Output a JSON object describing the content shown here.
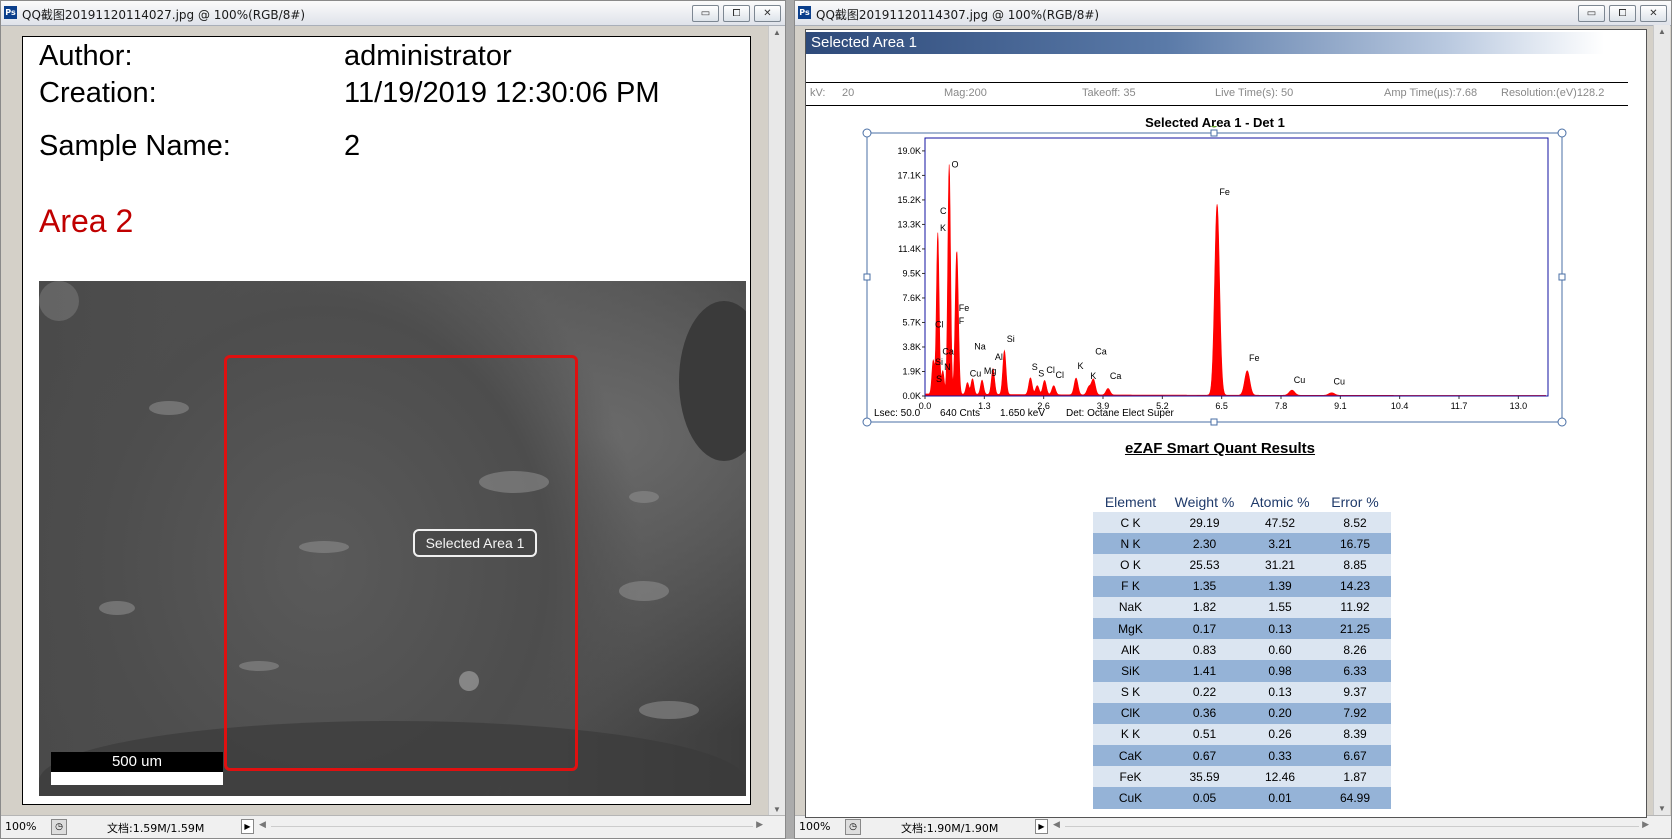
{
  "left_window": {
    "title": "QQ截图20191120114027.jpg @ 100%(RGB/8#)",
    "report": {
      "author_label": "Author:",
      "author_value": "administrator",
      "creation_label": "Creation:",
      "creation_value": "11/19/2019  12:30:06 PM",
      "sample_label": "Sample Name:",
      "sample_value": "2",
      "area_title": "Area 2"
    },
    "image": {
      "selection_label": "Selected Area 1",
      "scale_bar": "500 um"
    },
    "status": {
      "zoom": "100%",
      "doc": "文档:1.59M/1.59M"
    }
  },
  "right_window": {
    "title": "QQ截图20191120114307.jpg @ 100%(RGB/8#)",
    "header": "Selected Area 1",
    "params": {
      "kv_label": "kV:",
      "kv_value": "20",
      "mag": "Mag:200",
      "takeoff": "Takeoff: 35",
      "live_time": "Live Time(s): 50",
      "amp_time": "Amp Time(µs):7.68",
      "resolution": "Resolution:(eV)128.2"
    },
    "chart_footer": {
      "lsec": "Lsec: 50.0",
      "cnts": "640 Cnts",
      "kev": "1.650 keV",
      "det": "Det: Octane Elect Super"
    },
    "results_title": "eZAF Smart Quant Results",
    "results": {
      "headers": [
        "Element",
        "Weight %",
        "Atomic %",
        "Error %"
      ],
      "rows": [
        [
          "C K",
          "29.19",
          "47.52",
          "8.52"
        ],
        [
          "N K",
          "2.30",
          "3.21",
          "16.75"
        ],
        [
          "O K",
          "25.53",
          "31.21",
          "8.85"
        ],
        [
          "F K",
          "1.35",
          "1.39",
          "14.23"
        ],
        [
          "NaK",
          "1.82",
          "1.55",
          "11.92"
        ],
        [
          "MgK",
          "0.17",
          "0.13",
          "21.25"
        ],
        [
          "AlK",
          "0.83",
          "0.60",
          "8.26"
        ],
        [
          "SiK",
          "1.41",
          "0.98",
          "6.33"
        ],
        [
          "S K",
          "0.22",
          "0.13",
          "9.37"
        ],
        [
          "ClK",
          "0.36",
          "0.20",
          "7.92"
        ],
        [
          "K K",
          "0.51",
          "0.26",
          "8.39"
        ],
        [
          "CaK",
          "0.67",
          "0.33",
          "6.67"
        ],
        [
          "FeK",
          "35.59",
          "12.46",
          "1.87"
        ],
        [
          "CuK",
          "0.05",
          "0.01",
          "64.99"
        ]
      ]
    },
    "status": {
      "zoom": "100%",
      "doc": "文档:1.90M/1.90M"
    }
  },
  "chart_data": {
    "type": "area",
    "title": "Selected Area 1 - Det 1",
    "xlim": [
      0.0,
      13.65
    ],
    "ylim": [
      0,
      20000
    ],
    "x_ticks": [
      "0.0",
      "1.3",
      "2.6",
      "3.9",
      "5.2",
      "6.5",
      "7.8",
      "9.1",
      "10.4",
      "11.7",
      "13.0"
    ],
    "y_ticks": [
      "0.0K",
      "1.9K",
      "3.8K",
      "5.7K",
      "7.6K",
      "9.5K",
      "11.4K",
      "13.3K",
      "15.2K",
      "17.1K",
      "19.0K"
    ],
    "color": "#ff0000",
    "peaks": [
      {
        "x": 0.18,
        "y": 2600
      },
      {
        "x": 0.28,
        "y": 12500
      },
      {
        "x": 0.39,
        "y": 1800
      },
      {
        "x": 0.53,
        "y": 17800
      },
      {
        "x": 0.68,
        "y": 5800
      },
      {
        "x": 0.71,
        "y": 6700
      },
      {
        "x": 0.93,
        "y": 900
      },
      {
        "x": 1.04,
        "y": 1200
      },
      {
        "x": 1.25,
        "y": 1100
      },
      {
        "x": 1.49,
        "y": 2000
      },
      {
        "x": 1.74,
        "y": 3400
      },
      {
        "x": 2.31,
        "y": 1300
      },
      {
        "x": 2.46,
        "y": 700
      },
      {
        "x": 2.62,
        "y": 1100
      },
      {
        "x": 2.82,
        "y": 700
      },
      {
        "x": 3.31,
        "y": 1300
      },
      {
        "x": 3.59,
        "y": 600
      },
      {
        "x": 3.69,
        "y": 1200
      },
      {
        "x": 4.01,
        "y": 500
      },
      {
        "x": 6.4,
        "y": 14800
      },
      {
        "x": 7.06,
        "y": 1900
      },
      {
        "x": 8.04,
        "y": 400
      },
      {
        "x": 8.91,
        "y": 200
      }
    ],
    "labels": [
      {
        "text": "O",
        "x": 0.58,
        "y": 17700
      },
      {
        "text": "C",
        "x": 0.33,
        "y": 14100
      },
      {
        "text": "K",
        "x": 0.33,
        "y": 12800
      },
      {
        "text": "Fe",
        "x": 0.74,
        "y": 6600
      },
      {
        "text": "F",
        "x": 0.74,
        "y": 5600
      },
      {
        "text": "Cl",
        "x": 0.22,
        "y": 5300
      },
      {
        "text": "Ca",
        "x": 0.38,
        "y": 3200
      },
      {
        "text": "N",
        "x": 0.42,
        "y": 2000
      },
      {
        "text": "Si",
        "x": 0.22,
        "y": 2400
      },
      {
        "text": "S",
        "x": 0.24,
        "y": 1100
      },
      {
        "text": "Na",
        "x": 1.08,
        "y": 3600
      },
      {
        "text": "Al",
        "x": 1.53,
        "y": 2800
      },
      {
        "text": "Si",
        "x": 1.79,
        "y": 4200
      },
      {
        "text": "Cu",
        "x": 0.98,
        "y": 1500
      },
      {
        "text": "Mg",
        "x": 1.29,
        "y": 1700
      },
      {
        "text": "S",
        "x": 2.34,
        "y": 2000
      },
      {
        "text": "S",
        "x": 2.48,
        "y": 1500
      },
      {
        "text": "Cl",
        "x": 2.66,
        "y": 1800
      },
      {
        "text": "Cl",
        "x": 2.86,
        "y": 1400
      },
      {
        "text": "K",
        "x": 3.34,
        "y": 2100
      },
      {
        "text": "K",
        "x": 3.62,
        "y": 1300
      },
      {
        "text": "Ca",
        "x": 3.73,
        "y": 3200
      },
      {
        "text": "Ca",
        "x": 4.05,
        "y": 1300
      },
      {
        "text": "Fe",
        "x": 6.45,
        "y": 15600
      },
      {
        "text": "Fe",
        "x": 7.1,
        "y": 2700
      },
      {
        "text": "Cu",
        "x": 8.08,
        "y": 1000
      },
      {
        "text": "Cu",
        "x": 8.95,
        "y": 900
      }
    ]
  }
}
